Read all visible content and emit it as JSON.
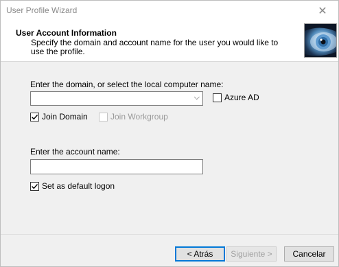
{
  "window": {
    "title": "User Profile Wizard",
    "close_glyph": "✕"
  },
  "header": {
    "title": "User Account  Information",
    "subtitle": "Specify the domain and account name for the user you would like to use the profile.",
    "image_icon": "eye-image"
  },
  "domain": {
    "label": "Enter the domain, or select the local computer name:",
    "value": "",
    "dropdown_glyph": "⌵"
  },
  "checkboxes": {
    "azure_ad": {
      "label": "Azure AD",
      "checked": false
    },
    "join_domain": {
      "label": "Join Domain",
      "checked": true
    },
    "join_workgroup": {
      "label": "Join Workgroup",
      "checked": false,
      "disabled": true
    },
    "default_logon": {
      "label": "Set as default logon",
      "checked": true
    }
  },
  "account": {
    "label": "Enter the account name:",
    "value": ""
  },
  "buttons": {
    "back": "< Atrás",
    "next": "Siguiente >",
    "cancel": "Cancelar"
  },
  "colors": {
    "accent": "#0078d7"
  }
}
